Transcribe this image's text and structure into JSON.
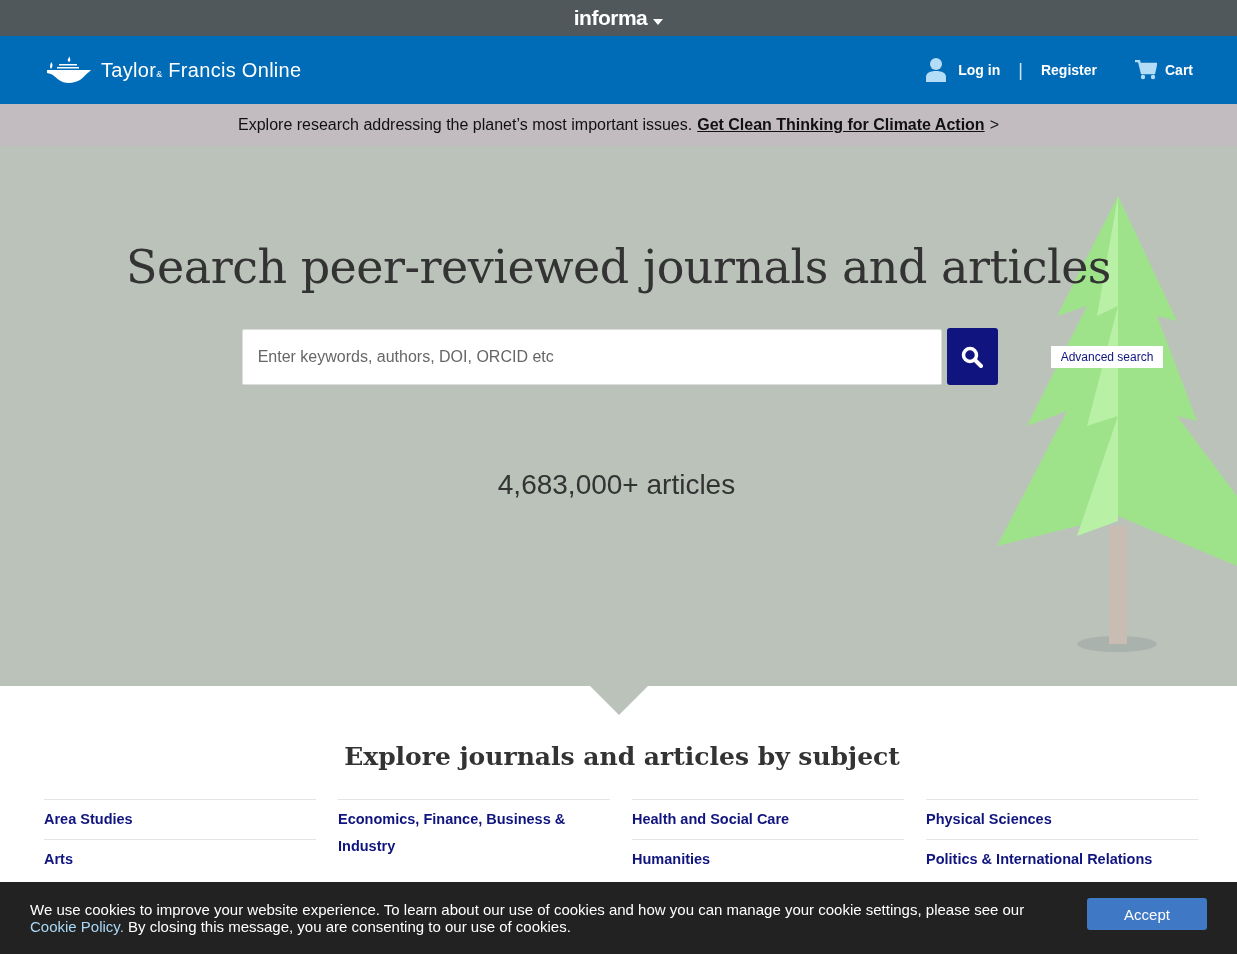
{
  "top_bar": {
    "brand": "informa"
  },
  "header": {
    "logo_text": "Taylor",
    "logo_amp": "&",
    "logo_text_2": "Francis Online",
    "login": "Log in",
    "separator": "|",
    "register": "Register",
    "cart": "Cart"
  },
  "banner": {
    "text": "Explore research addressing the planet’s most important issues.",
    "link": "Get Clean Thinking for Climate Action",
    "suffix": ">"
  },
  "hero": {
    "title": "Search peer-reviewed journals and articles",
    "search": {
      "placeholder": "Enter keywords, authors, DOI, ORCID etc"
    },
    "advanced_search": "Advanced search",
    "count": "4,683,000+ articles"
  },
  "subjects": {
    "title": "Explore journals and articles by subject",
    "columns": [
      [
        "Area Studies",
        "Arts"
      ],
      [
        "Economics, Finance, Business & Industry"
      ],
      [
        "Health and Social Care",
        "Humanities"
      ],
      [
        "Physical Sciences",
        "Politics & International Relations"
      ]
    ]
  },
  "cookie_notice": {
    "text": "We use cookies to improve your website experience. To learn about our use of cookies and how you can manage your cookie settings, please see our",
    "link": "Cookie Policy.",
    "text_2": "By closing this message, you are consenting to our use of cookies.",
    "button": "Accept"
  }
}
